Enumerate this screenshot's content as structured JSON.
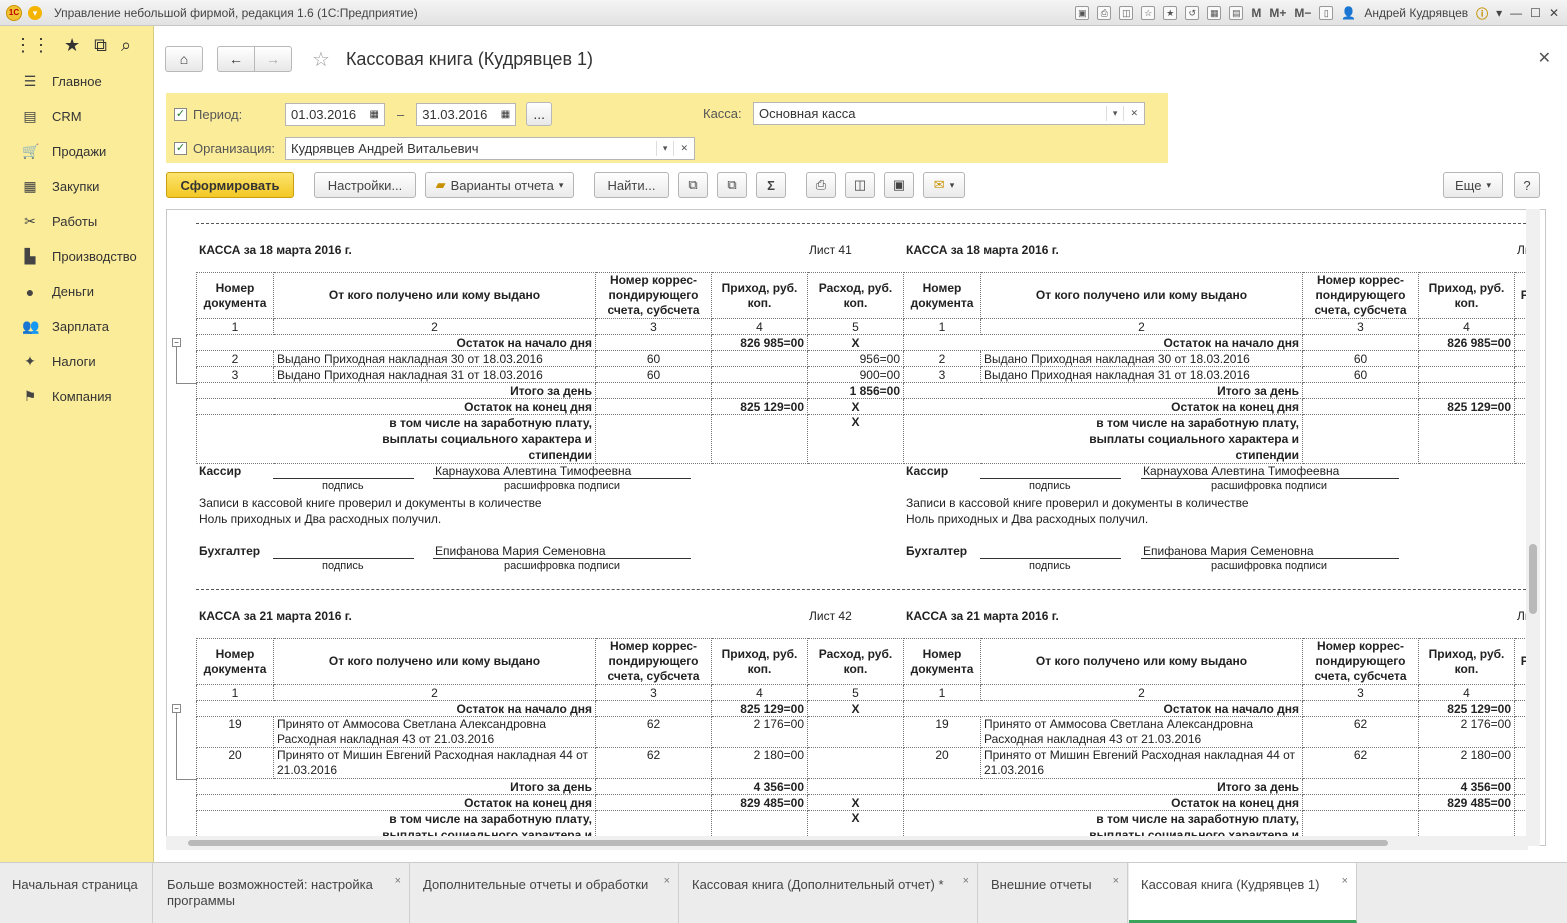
{
  "app": {
    "title": "Управление небольшой фирмой, редакция 1.6  (1С:Предприятие)",
    "user": "Андрей Кудрявцев"
  },
  "titlebar_tools": {
    "m": "M",
    "mplus": "M+",
    "mminus": "M−"
  },
  "sidebar": {
    "items": [
      {
        "label": "Главное"
      },
      {
        "label": "CRM"
      },
      {
        "label": "Продажи"
      },
      {
        "label": "Закупки"
      },
      {
        "label": "Работы"
      },
      {
        "label": "Производство"
      },
      {
        "label": "Деньги"
      },
      {
        "label": "Зарплата"
      },
      {
        "label": "Налоги"
      },
      {
        "label": "Компания"
      }
    ]
  },
  "form": {
    "title": "Кассовая книга (Кудрявцев 1)"
  },
  "filters": {
    "period_label": "Период:",
    "date_from": "01.03.2016",
    "dash": "–",
    "date_to": "31.03.2016",
    "more": "...",
    "kassa_label": "Касса:",
    "kassa_value": "Основная касса",
    "org_label": "Организация:",
    "org_value": "Кудрявцев Андрей Витальевич"
  },
  "toolbar": {
    "generate": "Сформировать",
    "settings": "Настройки...",
    "variants": "Варианты отчета",
    "find": "Найти...",
    "sigma": "Σ",
    "more": "Еще",
    "help": "?"
  },
  "report": {
    "headers": [
      "Номер документа",
      "От кого получено или кому выдано",
      "Номер коррес-пондирующего счета, субсчета",
      "Приход, руб. коп.",
      "Расход, руб. коп."
    ],
    "header_cut": "Р",
    "nums": [
      "1",
      "2",
      "3",
      "4",
      "5"
    ],
    "opening": "Остаток на начало дня",
    "total_day": "Итого за день",
    "closing": "Остаток на конец дня",
    "salary": "в том числе на заработную плату, выплаты социального характера и стипендии",
    "x": "X",
    "cashier": "Кассир",
    "cashier_name": "Карнаухова Алевтина Тимофеевна",
    "accountant": "Бухгалтер",
    "accountant_name": "Епифанова Мария Семеновна",
    "signature": "подпись",
    "decode": "расшифровка подписи",
    "check1": "Записи в кассовой книге проверил и документы в количестве",
    "check2": "Ноль  приходных и Два  расходных получил.",
    "day1": {
      "title": "КАССА за 18 марта 2016 г.",
      "sheet": "Лист 41",
      "sheet_cut": "Ли",
      "opening_in": "826 985=00",
      "rows": [
        {
          "num": "2",
          "text": "Выдано  Приходная накладная 30 от 18.03.2016",
          "acc": "60",
          "in": "",
          "out": "956=00"
        },
        {
          "num": "3",
          "text": "Выдано  Приходная накладная 31 от 18.03.2016",
          "acc": "60",
          "in": "",
          "out": "900=00"
        }
      ],
      "total_in": "",
      "total_out": "1 856=00",
      "closing_in": "825 129=00"
    },
    "day2": {
      "title": "КАССА за 21 марта 2016 г.",
      "sheet": "Лист 42",
      "sheet_cut": "Ли",
      "opening_in": "825 129=00",
      "rows": [
        {
          "num": "19",
          "text1": "Принято от Аммосова Светлана Александровна",
          "text2": "Расходная накладная 43 от 21.03.2016",
          "acc": "62",
          "in": "2 176=00",
          "out": ""
        },
        {
          "num": "20",
          "text1": "Принято от Мишин Евгений Расходная накладная 44 от",
          "text2": "21.03.2016",
          "acc": "62",
          "in": "2 180=00",
          "out": ""
        }
      ],
      "total_in": "4 356=00",
      "total_out": "",
      "closing_in": "829 485=00"
    }
  },
  "tabs": [
    {
      "label": "Начальная страница"
    },
    {
      "label": "Больше возможностей: настройка программы"
    },
    {
      "label": "Дополнительные отчеты и обработки"
    },
    {
      "label": "Кассовая книга (Дополнительный отчет) *"
    },
    {
      "label": "Внешние отчеты"
    },
    {
      "label": "Кассовая книга (Кудрявцев 1)"
    }
  ]
}
